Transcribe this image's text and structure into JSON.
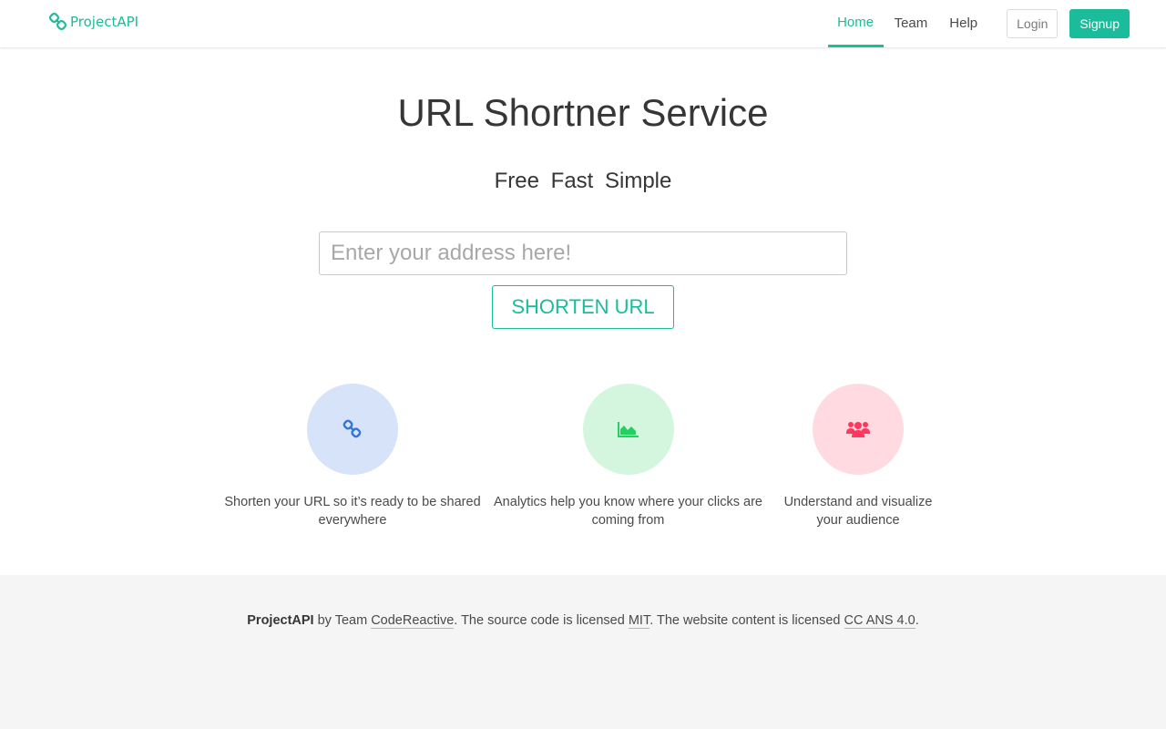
{
  "navbar": {
    "brand": "ProjectAPI",
    "links": [
      "Home",
      "Team",
      "Help"
    ],
    "login_label": "Login",
    "signup_label": "Signup"
  },
  "hero": {
    "title": "URL Shortner Service",
    "subtitle": "Free Fast Simple",
    "input_placeholder": "Enter your address here!",
    "input_value": "",
    "button_label": "SHORTEN URL"
  },
  "features": [
    {
      "icon": "link-icon",
      "color": "#3273dc",
      "bg": "#d6e3f8",
      "text": "Shorten your URL so it’s ready to be shared everywhere"
    },
    {
      "icon": "area-chart-icon",
      "color": "#23d160",
      "bg": "#d4f6df",
      "text": "Analytics help you know where your clicks are coming from"
    },
    {
      "icon": "users-icon",
      "color": "#ff3860",
      "bg": "#ffdbe1",
      "text": "Understand and visualize your audience"
    }
  ],
  "footer": {
    "brand": "ProjectAPI",
    "by": " by Team ",
    "team": "CodeReactive",
    "source_text": ". The source code is licensed ",
    "license": "MIT",
    "content_text": ". The website content is licensed ",
    "content_license": "CC ANS 4.0",
    "end": "."
  },
  "colors": {
    "accent": "#1abc9c"
  }
}
